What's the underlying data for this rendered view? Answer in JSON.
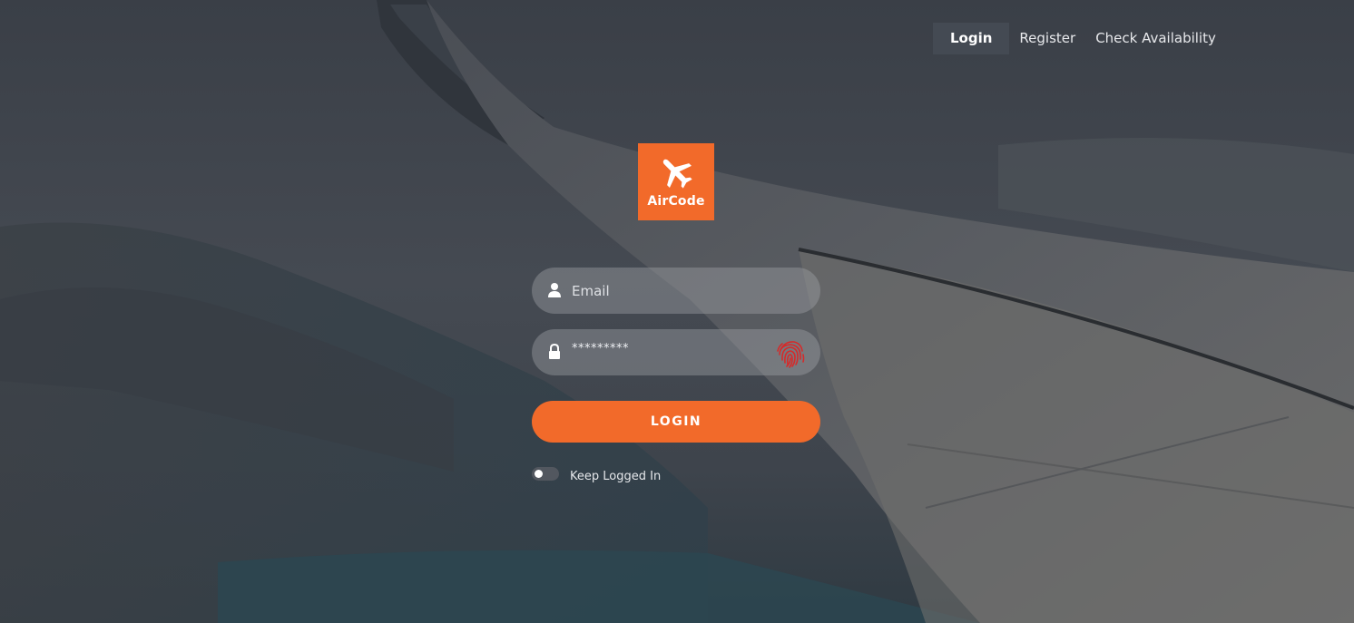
{
  "nav": {
    "items": [
      {
        "label": "Login",
        "active": true
      },
      {
        "label": "Register",
        "active": false
      },
      {
        "label": "Check Availability",
        "active": false
      }
    ]
  },
  "logo": {
    "text": "AirCode",
    "icon": "airplane-icon",
    "color": "#f26a2a"
  },
  "form": {
    "email": {
      "placeholder": "Email",
      "value": "",
      "icon": "user-icon"
    },
    "password": {
      "value": "*********",
      "icon": "lock-icon",
      "extra_icon": "fingerprint-icon"
    },
    "login_button": {
      "label": "LOGIN",
      "color": "#f26a2a"
    },
    "keep_logged_in": {
      "label": "Keep Logged In",
      "checked": false
    }
  },
  "background": {
    "subject": "airplane-wing-over-clouds"
  }
}
